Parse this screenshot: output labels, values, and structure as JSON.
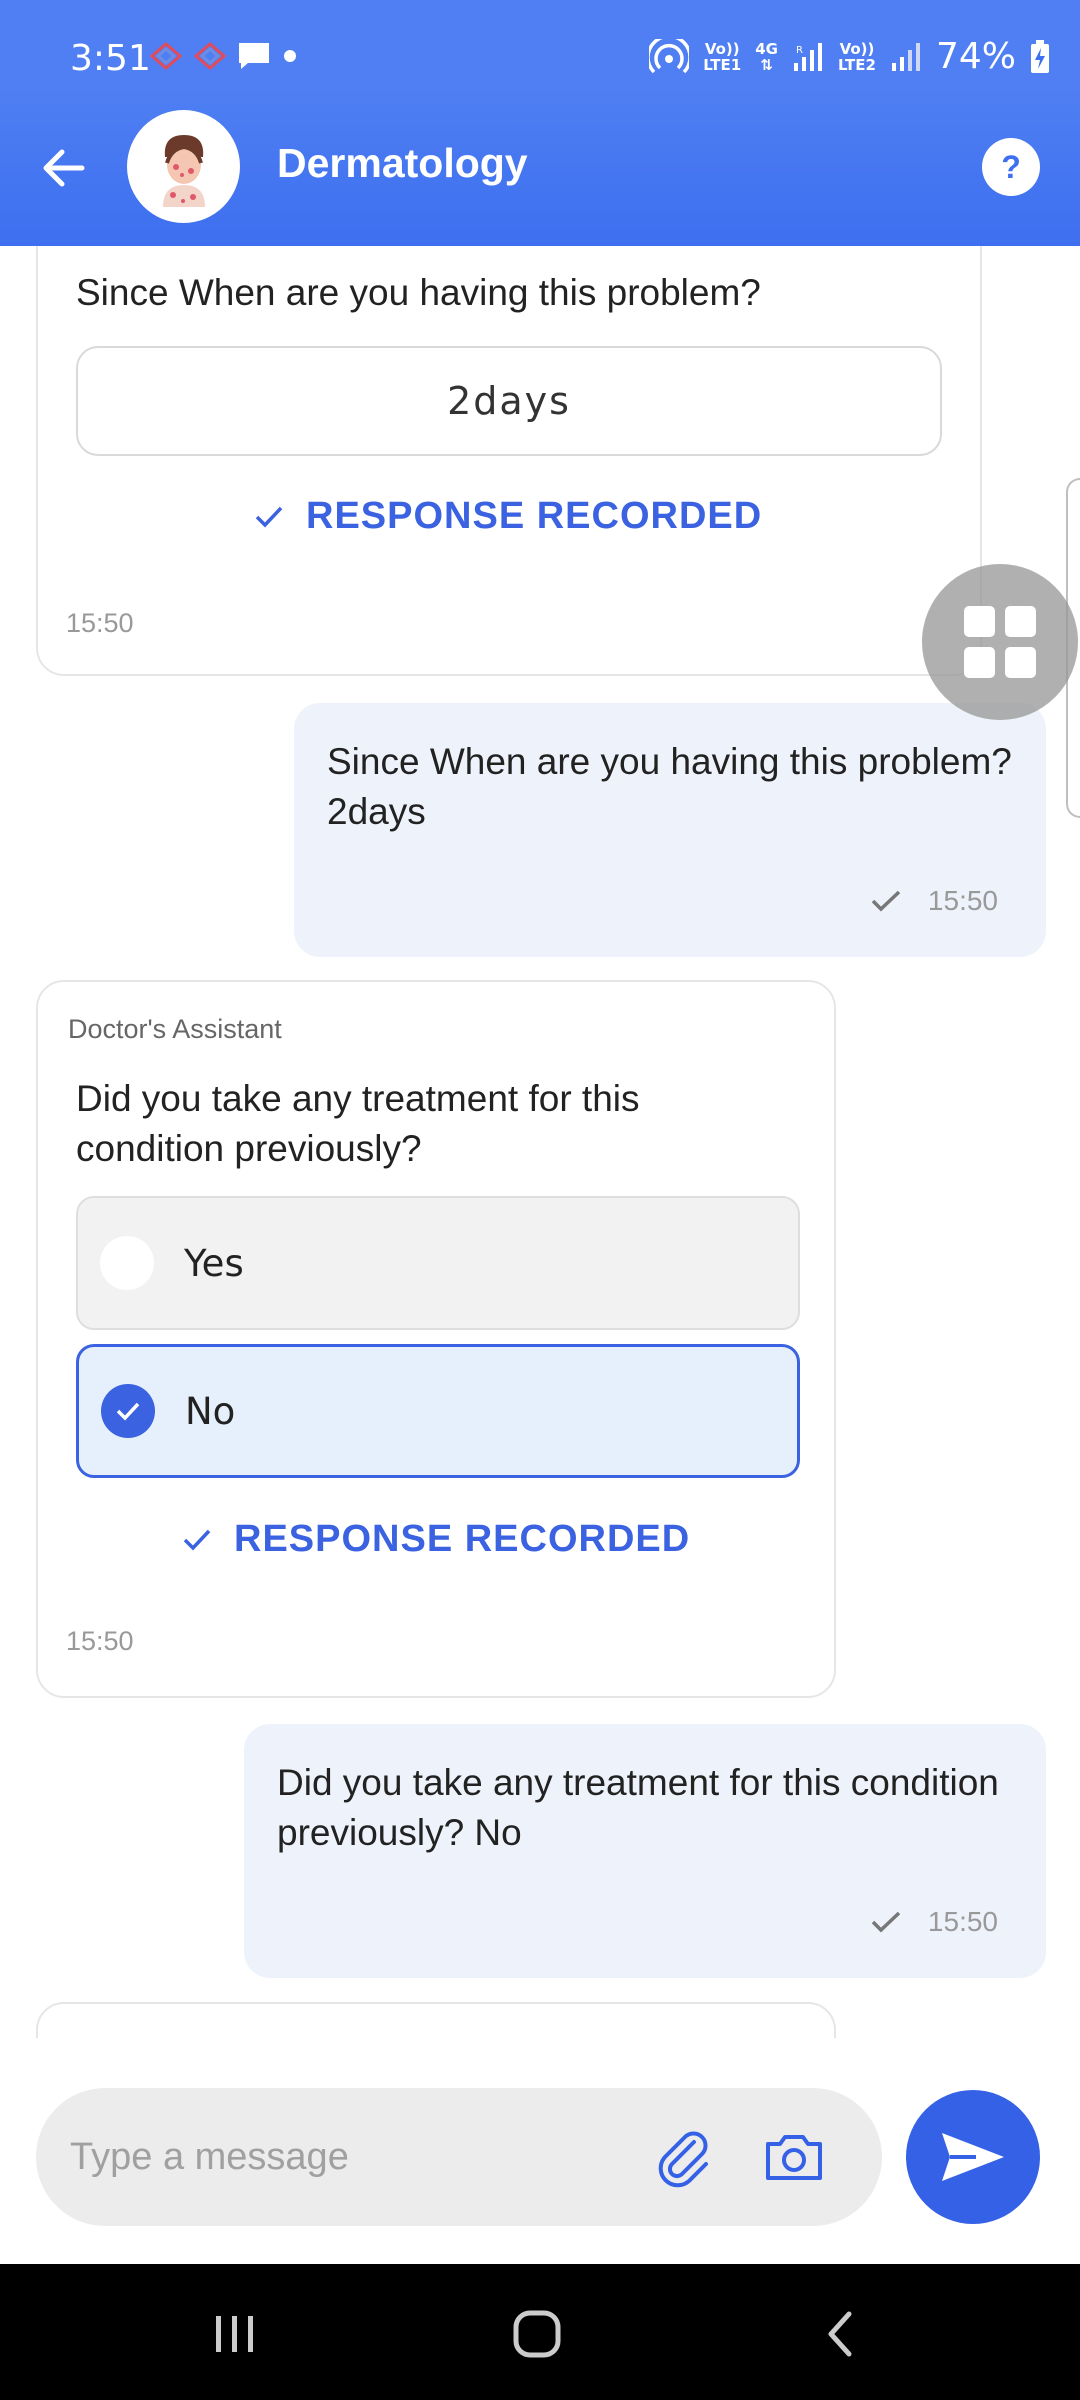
{
  "status_bar": {
    "time": "3:51",
    "sim1_label_top": "Vo))",
    "sim1_label_bottom": "LTE1",
    "net_label_top": "4G",
    "net_label_bottom": "R",
    "sim2_label_top": "Vo))",
    "sim2_label_bottom": "LTE2",
    "battery": "74%"
  },
  "header": {
    "title": "Dermatology",
    "help_label": "?"
  },
  "messages": {
    "card1": {
      "question": "Since When are you having this problem?",
      "answer": "2days",
      "status": "RESPONSE RECORDED",
      "time": "15:50"
    },
    "bubble1": {
      "line1": "Since When are you having this problem?",
      "line2": "2days",
      "time": "15:50"
    },
    "card2": {
      "sender": "Doctor's Assistant",
      "question_line1": "Did you take any treatment for this",
      "question_line2": "condition previously?",
      "options": [
        {
          "label": "Yes",
          "selected": false
        },
        {
          "label": "No",
          "selected": true
        }
      ],
      "status": "RESPONSE RECORDED",
      "time": "15:50"
    },
    "bubble2": {
      "line1": "Did you take any treatment for this condition",
      "line2": "previously? No",
      "time": "15:50"
    }
  },
  "input": {
    "placeholder": "Type a message"
  },
  "colors": {
    "header": "#3d6ff0",
    "accent": "#3b62e0",
    "bubble": "#eef2fb",
    "send": "#3561e6"
  },
  "icons": [
    "back-arrow-icon",
    "doctor-avatar-icon",
    "help-icon",
    "check-icon",
    "grid-icon",
    "attach-icon",
    "camera-icon",
    "send-icon",
    "recent-apps-icon",
    "home-icon",
    "nav-back-icon"
  ]
}
